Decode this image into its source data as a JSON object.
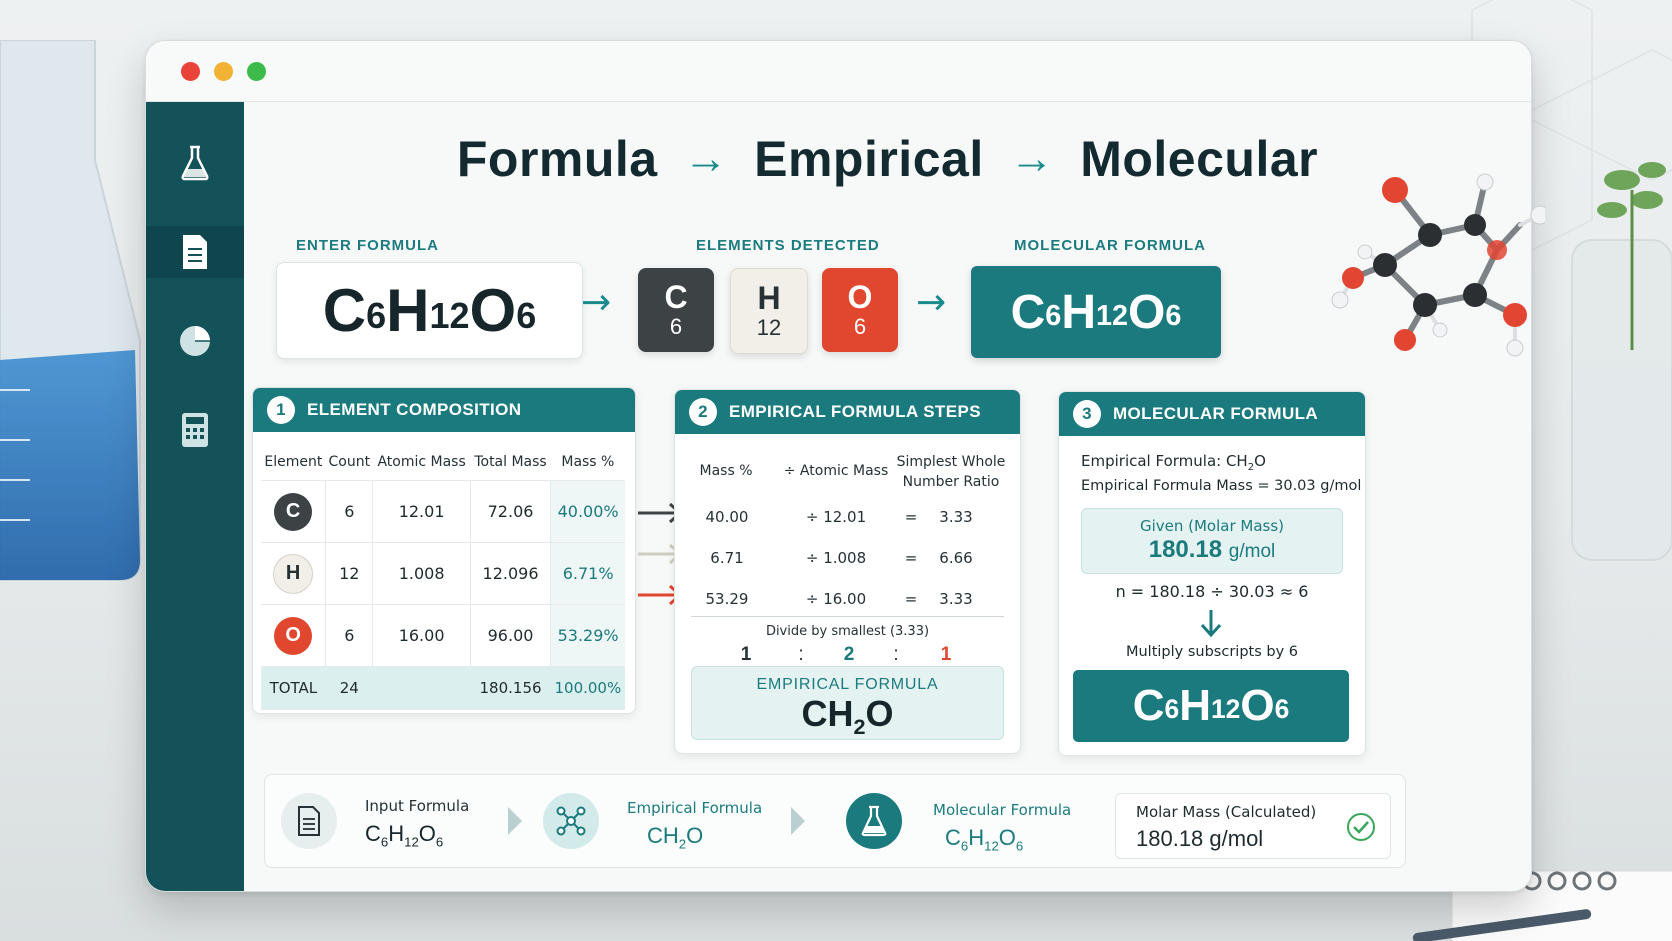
{
  "window": {
    "controls": [
      "close",
      "minimize",
      "maximize"
    ]
  },
  "sidebar": {
    "items": [
      {
        "icon": "flask-icon"
      },
      {
        "icon": "document-icon",
        "active": true
      },
      {
        "icon": "pie-chart-icon"
      },
      {
        "icon": "calculator-icon"
      }
    ]
  },
  "header": {
    "title_1": "Formula",
    "title_2": "Empirical",
    "title_3": "Molecular"
  },
  "input": {
    "label": "ENTER FORMULA",
    "formula": {
      "c": "C",
      "c_sub": "6",
      "h": "H",
      "h_sub": "12",
      "o": "O",
      "o_sub": "6"
    }
  },
  "detected": {
    "label": "ELEMENTS DETECTED",
    "elements": [
      {
        "symbol": "C",
        "count": "6"
      },
      {
        "symbol": "H",
        "count": "12"
      },
      {
        "symbol": "O",
        "count": "6"
      }
    ]
  },
  "molecular_top": {
    "label": "MOLECULAR FORMULA",
    "formula": {
      "c": "C",
      "c_sub": "6",
      "h": "H",
      "h_sub": "12",
      "o": "O",
      "o_sub": "6"
    }
  },
  "composition": {
    "step": "1",
    "title": "ELEMENT COMPOSITION",
    "columns": [
      "Element",
      "Count",
      "Atomic Mass",
      "Total Mass",
      "Mass %"
    ],
    "rows": [
      {
        "element": "C",
        "count": "6",
        "atomic_mass": "12.01",
        "total_mass": "72.06",
        "mass_pct": "40.00%"
      },
      {
        "element": "H",
        "count": "12",
        "atomic_mass": "1.008",
        "total_mass": "12.096",
        "mass_pct": "6.71%"
      },
      {
        "element": "O",
        "count": "6",
        "atomic_mass": "16.00",
        "total_mass": "96.00",
        "mass_pct": "53.29%"
      }
    ],
    "total": {
      "label": "TOTAL",
      "count": "24",
      "total_mass": "180.156",
      "mass_pct": "100.00%"
    }
  },
  "empirical": {
    "step": "2",
    "title": "EMPIRICAL FORMULA STEPS",
    "col_mass": "Mass %",
    "col_div": "÷ Atomic Mass",
    "col_ratio_1": "Simplest Whole",
    "col_ratio_2": "Number Ratio",
    "rows": [
      {
        "mass": "40.00",
        "div": "÷ 12.01",
        "eq": "=",
        "ratio": "3.33"
      },
      {
        "mass": "6.71",
        "div": "÷ 1.008",
        "eq": "=",
        "ratio": "6.66"
      },
      {
        "mass": "53.29",
        "div": "÷ 16.00",
        "eq": "=",
        "ratio": "3.33"
      }
    ],
    "divide_note": "Divide by smallest (3.33)",
    "ratio": {
      "c": "1",
      "colon": ":",
      "h": "2",
      "o": "1"
    },
    "result_label": "EMPIRICAL FORMULA",
    "result": {
      "main": "CH",
      "sub": "2",
      "end": "O"
    }
  },
  "molecular": {
    "step": "3",
    "title": "MOLECULAR FORMULA",
    "emp_formula_text": "Empirical Formula: CH",
    "emp_formula_sub": "2",
    "emp_formula_end": "O",
    "emp_mass": "Empirical Formula Mass = 30.03 g/mol",
    "given_label": "Given (Molar Mass)",
    "given_value": "180.18",
    "given_unit": "g/mol",
    "n_calc": "n  =  180.18 ÷ 30.03   ≈ 6",
    "multiply_note": "Multiply subscripts by 6",
    "result": {
      "c": "C",
      "c_sub": "6",
      "h": "H",
      "h_sub": "12",
      "o": "O",
      "o_sub": "6"
    }
  },
  "summary": {
    "input_label": "Input Formula",
    "input_value": {
      "c": "C",
      "c_sub": "6",
      "h": "H",
      "h_sub": "12",
      "o": "O",
      "o_sub": "6"
    },
    "empirical_label": "Empirical Formula",
    "empirical_value": {
      "main": "CH",
      "sub": "2",
      "end": "O"
    },
    "molecular_label": "Molecular Formula",
    "molecular_value": {
      "c": "C",
      "c_sub": "6",
      "h": "H",
      "h_sub": "12",
      "o": "O",
      "o_sub": "6"
    },
    "molar_label": "Molar Mass (Calculated)",
    "molar_value": "180.18 g/mol"
  },
  "colors": {
    "teal": "#1b7a7d",
    "sidebar": "#14525a",
    "carbon": "#3d4244",
    "hydrogen": "#f1efe8",
    "oxygen": "#e0472e"
  }
}
